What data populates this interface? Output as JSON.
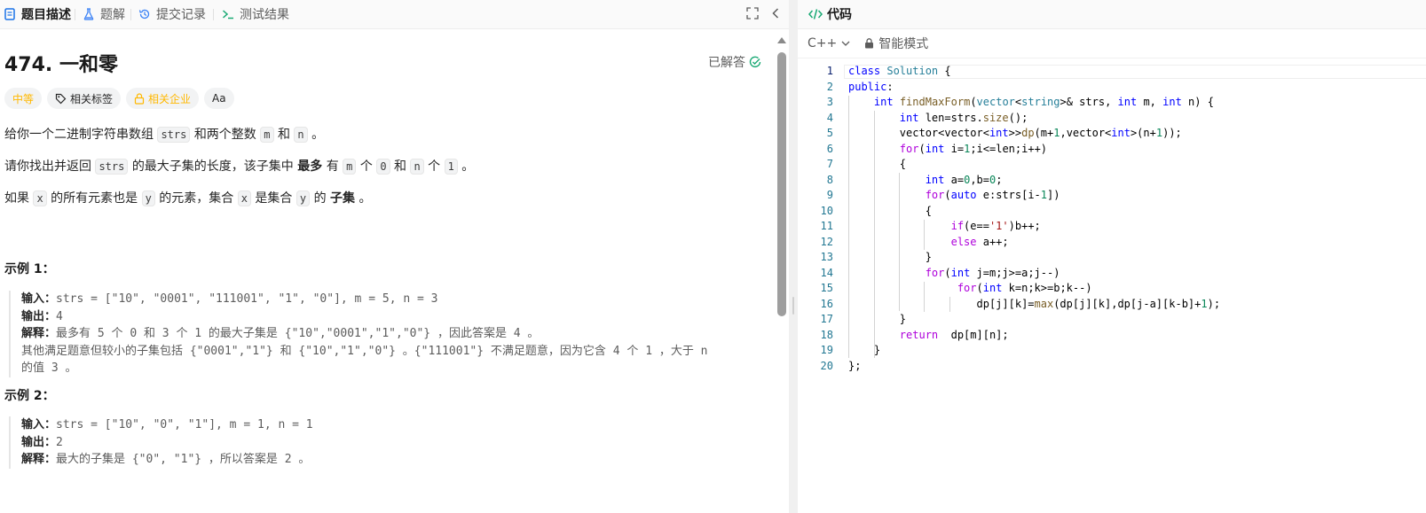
{
  "left_tabs": [
    {
      "label": "题目描述",
      "icon": "description-icon",
      "active": true
    },
    {
      "label": "题解",
      "icon": "flask-icon",
      "active": false
    },
    {
      "label": "提交记录",
      "icon": "history-icon",
      "active": false
    },
    {
      "label": "测试结果",
      "icon": "terminal-icon",
      "active": false
    }
  ],
  "problem": {
    "title": "474. 一和零",
    "status": "已解答",
    "tags": {
      "difficulty": "中等",
      "related_tags": "相关标签",
      "related_companies": "相关企业",
      "translate": "Aa"
    },
    "p1": {
      "a": "给你一个二进制字符串数组",
      "code1": "strs",
      "b": "和两个整数",
      "code2": "m",
      "c": "和",
      "code3": "n",
      "d": "。"
    },
    "p2": {
      "a": "请你找出并返回",
      "code1": "strs",
      "b": "的最大子集的长度，该子集中",
      "bold": "最多",
      "c": "有",
      "code2": "m",
      "d": "个",
      "code3": "0",
      "e": "和",
      "code4": "n",
      "f": "个",
      "code5": "1",
      "g": "。"
    },
    "p3": {
      "a": "如果",
      "code1": "x",
      "b": "的所有元素也是",
      "code2": "y",
      "c": "的元素，集合",
      "code3": "x",
      "d": "是集合",
      "code4": "y",
      "e": "的",
      "bold": "子集",
      "f": "。"
    },
    "example1": {
      "heading": "示例 1：",
      "input_label": "输入：",
      "input": "strs = [\"10\", \"0001\", \"111001\", \"1\", \"0\"], m = 5, n = 3",
      "output_label": "输出：",
      "output": "4",
      "explain_label": "解释：",
      "explain1": "最多有 5 个 0 和 3 个 1 的最大子集是 {\"10\",\"0001\",\"1\",\"0\"} ，因此答案是 4 。",
      "explain2": "其他满足题意但较小的子集包括 {\"0001\",\"1\"} 和 {\"10\",\"1\",\"0\"} 。{\"111001\"} 不满足题意，因为它含 4 个 1 ，大于 n",
      "explain3": "的值 3 。"
    },
    "example2": {
      "heading": "示例 2：",
      "input_label": "输入：",
      "input": "strs = [\"10\", \"0\", \"1\"], m = 1, n = 1",
      "output_label": "输出：",
      "output": "2",
      "explain_label": "解释：",
      "explain": "最大的子集是 {\"0\", \"1\"} ，所以答案是 2 。"
    }
  },
  "code_panel": {
    "title": "代码",
    "language": "C++",
    "mode": "智能模式",
    "lines": [
      "class Solution {",
      "public:",
      "    int findMaxForm(vector<string>& strs, int m, int n) {",
      "        int len=strs.size();",
      "        vector<vector<int>>dp(m+1,vector<int>(n+1));",
      "        for(int i=1;i<=len;i++)",
      "        {",
      "            int a=0,b=0;",
      "            for(auto e:strs[i-1])",
      "            {",
      "                if(e=='1')b++;",
      "                else a++;",
      "            }",
      "            for(int j=m;j>=a;j--)",
      "                 for(int k=n;k>=b;k--)",
      "                    dp[j][k]=max(dp[j][k],dp[j-a][k-b]+1);",
      "        }",
      "        return  dp[m][n];",
      "    }",
      "};"
    ]
  }
}
